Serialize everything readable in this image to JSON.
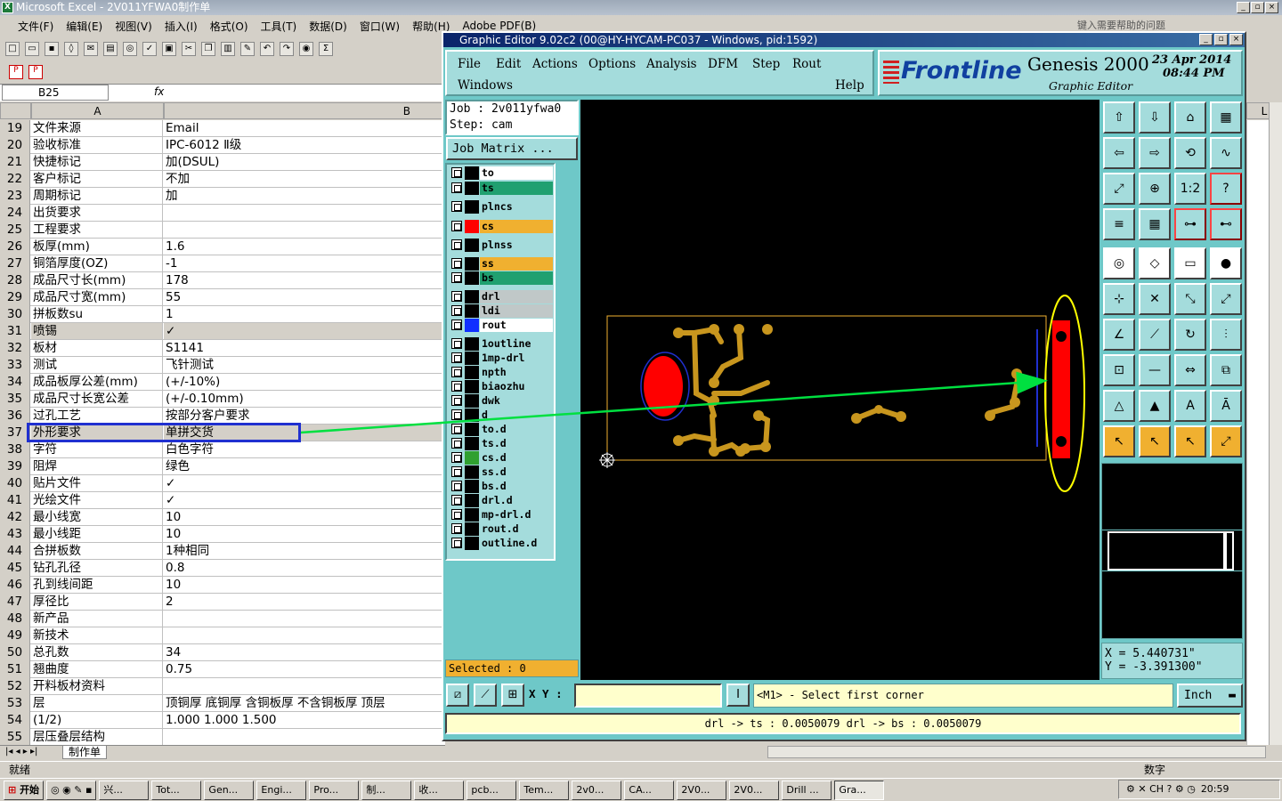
{
  "excel": {
    "title": "Microsoft Excel - 2V011YFWA0制作单",
    "menu": [
      "文件(F)",
      "编辑(E)",
      "视图(V)",
      "插入(I)",
      "格式(O)",
      "工具(T)",
      "数据(D)",
      "窗口(W)",
      "帮助(H)",
      "Adobe PDF(B)"
    ],
    "help_prompt": "键入需要帮助的问题",
    "name_box": "B25",
    "fx": "fx",
    "col_a": "A",
    "col_b": "B",
    "col_l": "L",
    "rows": [
      {
        "n": "19",
        "a": "文件来源",
        "b": "Email"
      },
      {
        "n": "20",
        "a": "验收标准",
        "b": "IPC-6012 Ⅱ级"
      },
      {
        "n": "21",
        "a": "快捷标记",
        "b": "加(DSUL)"
      },
      {
        "n": "22",
        "a": "客户标记",
        "b": "不加"
      },
      {
        "n": "23",
        "a": "周期标记",
        "b": "加"
      },
      {
        "n": "24",
        "a": "出货要求",
        "b": ""
      },
      {
        "n": "25",
        "a": "工程要求",
        "b": ""
      },
      {
        "n": "26",
        "a": "板厚(mm)",
        "b": "1.6"
      },
      {
        "n": "27",
        "a": "铜箔厚度(OZ)",
        "b": "-1"
      },
      {
        "n": "28",
        "a": "成品尺寸长(mm)",
        "b": "178"
      },
      {
        "n": "29",
        "a": "成品尺寸宽(mm)",
        "b": "55"
      },
      {
        "n": "30",
        "a": "拼板数su",
        "b": "1"
      },
      {
        "n": "31",
        "a": "喷锡",
        "b": "✓"
      },
      {
        "n": "32",
        "a": "板材",
        "b": "S1141"
      },
      {
        "n": "33",
        "a": "测试",
        "b": "飞针测试"
      },
      {
        "n": "34",
        "a": "成品板厚公差(mm)",
        "b": "(+/-10%)"
      },
      {
        "n": "35",
        "a": "成品尺寸长宽公差",
        "b": "(+/-0.10mm)"
      },
      {
        "n": "36",
        "a": "过孔工艺",
        "b": "按部分客户要求"
      },
      {
        "n": "37",
        "a": "外形要求",
        "b": "单拼交货"
      },
      {
        "n": "38",
        "a": "字符",
        "b": "白色字符"
      },
      {
        "n": "39",
        "a": "阻焊",
        "b": "绿色"
      },
      {
        "n": "40",
        "a": "贴片文件",
        "b": "✓"
      },
      {
        "n": "41",
        "a": "光绘文件",
        "b": "✓"
      },
      {
        "n": "42",
        "a": "最小线宽",
        "b": "10"
      },
      {
        "n": "43",
        "a": "最小线距",
        "b": "10"
      },
      {
        "n": "44",
        "a": "合拼板数",
        "b": "1种相同"
      },
      {
        "n": "45",
        "a": "钻孔孔径",
        "b": "0.8"
      },
      {
        "n": "46",
        "a": "孔到线间距",
        "b": "10"
      },
      {
        "n": "47",
        "a": "厚径比",
        "b": "2"
      },
      {
        "n": "48",
        "a": "新产品",
        "b": ""
      },
      {
        "n": "49",
        "a": "新技术",
        "b": ""
      },
      {
        "n": "50",
        "a": "总孔数",
        "b": "34"
      },
      {
        "n": "51",
        "a": "翘曲度",
        "b": "0.75"
      },
      {
        "n": "52",
        "a": "开料板材资料",
        "b": ""
      },
      {
        "n": "53",
        "a": "层",
        "b": "顶铜厚  底铜厚  含铜板厚  不含铜板厚  顶层"
      },
      {
        "n": "54",
        "a": "(1/2)",
        "b": "1.000  1.000   1.500"
      },
      {
        "n": "55",
        "a": "层压叠层结构",
        "b": ""
      }
    ],
    "sheet_tab": "制作单",
    "status_left": "就绪",
    "status_right": "数字"
  },
  "genesis": {
    "title": "Graphic Editor 9.02c2 (00@HY-HYCAM-PC037 - Windows, pid:1592)",
    "menu": [
      "File",
      "Edit",
      "Actions",
      "Options",
      "Analysis",
      "DFM",
      "Step",
      "Rout"
    ],
    "menu2": [
      "Windows",
      "Help"
    ],
    "logo": "Frontline",
    "product": "Genesis 2000",
    "subtitle": "Graphic Editor",
    "date": "23 Apr 2014",
    "time": "08:44 PM",
    "job": "Job : 2v011yfwa0",
    "step": "Step: cam",
    "job_matrix": "Job Matrix ...",
    "layers": [
      {
        "name": "to",
        "color": "#ffffff"
      },
      {
        "name": "ts",
        "color": "#20a070"
      },
      {
        "name": "plncs",
        "color": "#a4dcdc"
      },
      {
        "name": "cs",
        "color": "#f0b030"
      },
      {
        "name": "plnss",
        "color": "#a4dcdc"
      },
      {
        "name": "ss",
        "color": "#f0b030"
      },
      {
        "name": "bs",
        "color": "#20a070"
      },
      {
        "name": "drl",
        "color": "#c0c8c8"
      },
      {
        "name": "ldi",
        "color": "#c0c8c8"
      },
      {
        "name": "rout",
        "color": "#ffffff"
      },
      {
        "name": "1outline",
        "color": "#a4dcdc"
      },
      {
        "name": "1mp-drl",
        "color": "#a4dcdc"
      },
      {
        "name": "npth",
        "color": "#a4dcdc"
      },
      {
        "name": "biaozhu",
        "color": "#a4dcdc"
      },
      {
        "name": "dwk",
        "color": "#a4dcdc"
      },
      {
        "name": "d",
        "color": "#a4dcdc"
      },
      {
        "name": "to.d",
        "color": "#a4dcdc"
      },
      {
        "name": "ts.d",
        "color": "#a4dcdc"
      },
      {
        "name": "cs.d",
        "color": "#a4dcdc"
      },
      {
        "name": "ss.d",
        "color": "#a4dcdc"
      },
      {
        "name": "bs.d",
        "color": "#a4dcdc"
      },
      {
        "name": "drl.d",
        "color": "#a4dcdc"
      },
      {
        "name": "mp-drl.d",
        "color": "#a4dcdc"
      },
      {
        "name": "rout.d",
        "color": "#a4dcdc"
      },
      {
        "name": "outline.d",
        "color": "#a4dcdc"
      }
    ],
    "selected": "Selected : 0",
    "xy_label": "X Y :",
    "prompt": "<M1> - Select first corner",
    "unit": "Inch",
    "coord_x": "X = 5.440731\"",
    "coord_y": "Y = -3.391300\"",
    "drl_info": "drl -> ts : 0.0050079   drl -> bs : 0.0050079",
    "ratio_btn": "1:2"
  },
  "taskbar": {
    "start": "开始",
    "items": [
      "兴...",
      "Tot...",
      "Gen...",
      "Engi...",
      "Pro...",
      "制...",
      "收...",
      "pcb...",
      "Tem...",
      "2v0...",
      "CA...",
      "2V0...",
      "2V0...",
      "Drill ...",
      "Gra..."
    ],
    "clock": "20:59"
  },
  "colors": {
    "copper": "#c8961e",
    "pad": "#ff0000",
    "outline": "#ffff00",
    "arrow": "#00e040",
    "highlight": "#2030d0"
  }
}
